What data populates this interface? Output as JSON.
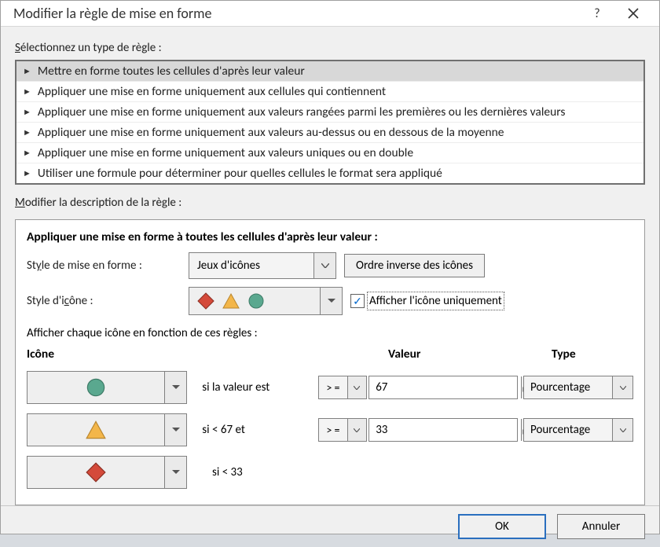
{
  "title": "Modifier la règle de mise en forme",
  "sectionSelectRule": "Sélectionnez un type de règle :",
  "ruleTypes": {
    "r0": "Mettre en forme toutes les cellules d'après leur valeur",
    "r1": "Appliquer une mise en forme uniquement aux cellules qui contiennent",
    "r2": "Appliquer une mise en forme uniquement aux valeurs rangées parmi les premières ou les dernières valeurs",
    "r3": "Appliquer une mise en forme uniquement aux valeurs au-dessus ou en dessous de la moyenne",
    "r4": "Appliquer une mise en forme uniquement aux valeurs uniques ou en double",
    "r5": "Utiliser une formule pour déterminer pour quelles cellules le format sera appliqué"
  },
  "sectionEditDesc": "Modifier la description de la règle :",
  "descHeading": "Appliquer une mise en forme à toutes les cellules d'après leur valeur :",
  "labels": {
    "formatStyle": "Style de mise en forme :",
    "iconStyle": "Style d'icône :",
    "formatStyleValue": "Jeux d'icônes",
    "reverseOrder": "Ordre inverse des icônes",
    "showIconOnly": "Afficher l'icône uniquement",
    "displayEachIcon": "Afficher chaque icône en fonction de ces règles :",
    "colIcon": "Icône",
    "colValue": "Valeur",
    "colType": "Type"
  },
  "rows": {
    "row1": {
      "text": "si la valeur est",
      "op": "> =",
      "value": "67",
      "type": "Pourcentage"
    },
    "row2": {
      "text": "si < 67 et",
      "op": "> =",
      "value": "33",
      "type": "Pourcentage"
    },
    "row3": {
      "text": "si < 33"
    }
  },
  "buttons": {
    "ok": "OK",
    "cancel": "Annuler"
  },
  "icons": {
    "greenCircle": "#5aa88f",
    "yellowTriangle": "#f3b64a",
    "redDiamond": "#d44a3a"
  }
}
